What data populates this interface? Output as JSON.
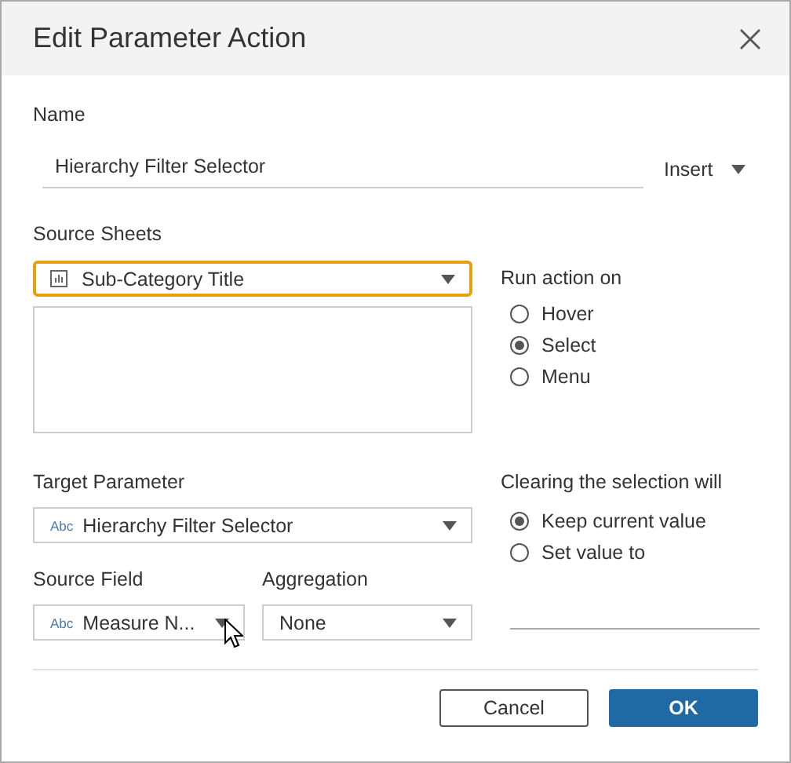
{
  "window": {
    "title": "Edit Parameter Action"
  },
  "name": {
    "label": "Name",
    "value": "Hierarchy Filter Selector",
    "insert": "Insert"
  },
  "source_sheets": {
    "label": "Source Sheets",
    "value": "Sub-Category Title",
    "focused": true
  },
  "run_action_on": {
    "label": "Run action on",
    "options": [
      {
        "label": "Hover",
        "selected": false
      },
      {
        "label": "Select",
        "selected": true
      },
      {
        "label": "Menu",
        "selected": false
      }
    ]
  },
  "target_parameter": {
    "label": "Target Parameter",
    "type_label": "Abc",
    "value": "Hierarchy Filter Selector"
  },
  "clearing": {
    "label": "Clearing the selection will",
    "options": [
      {
        "label": "Keep current value",
        "selected": true
      },
      {
        "label": "Set value to",
        "selected": false
      }
    ]
  },
  "source_field": {
    "label": "Source Field",
    "type_label": "Abc",
    "value": "Measure N..."
  },
  "aggregation": {
    "label": "Aggregation",
    "value": "None"
  },
  "buttons": [
    {
      "label": "Cancel",
      "kind": "secondary"
    },
    {
      "label": "OK",
      "kind": "primary"
    }
  ]
}
